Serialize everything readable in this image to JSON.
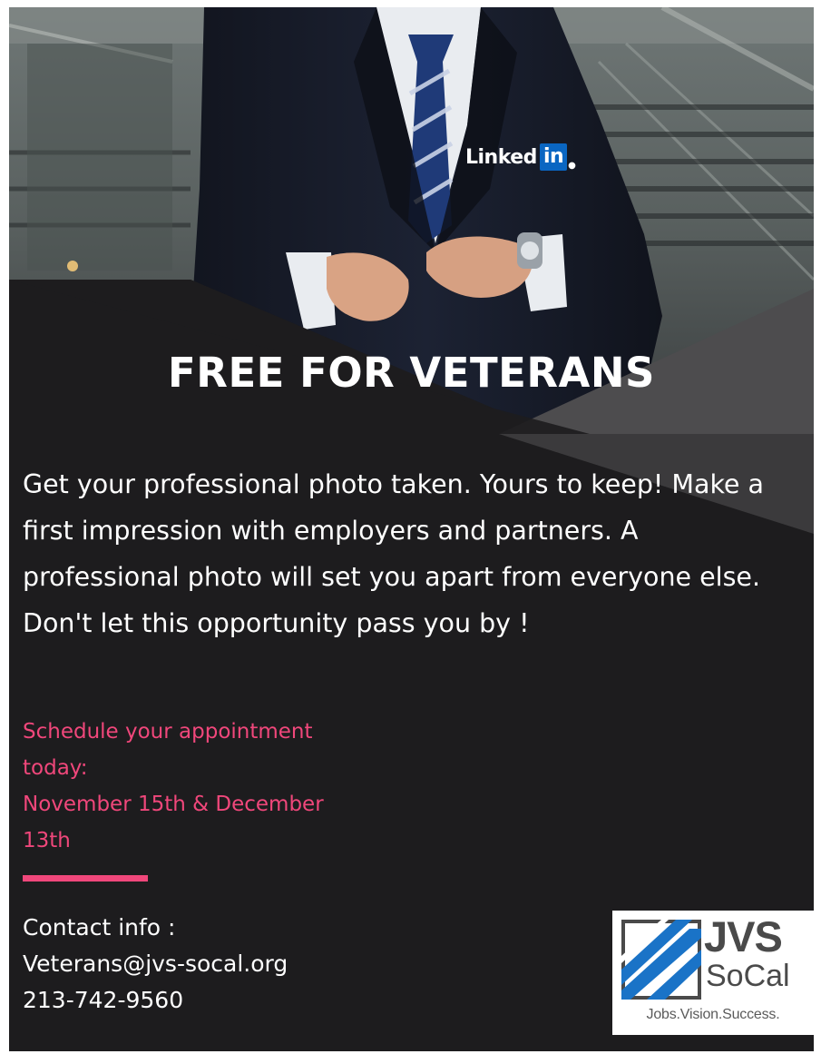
{
  "brand": {
    "linkedin_word": "Linked",
    "linkedin_in": "in"
  },
  "headline": "FREE FOR VETERANS",
  "body_text": "Get your professional photo taken. Yours to keep! Make a first impression with employers and partners. A professional photo will set you apart from everyone else. Don't let this opportunity pass you by !",
  "schedule": {
    "line1": "Schedule your appointment",
    "line2": "today:",
    "line3": "November 15th & December",
    "line4": "13th"
  },
  "contact": {
    "label": "Contact info :",
    "email": "Veterans@jvs-socal.org",
    "phone": "213-742-9560"
  },
  "logo": {
    "name": "JVS",
    "region": "SoCal",
    "tagline": "Jobs.Vision.Success."
  },
  "colors": {
    "background": "#1d1c1e",
    "accent_pink": "#f0477b",
    "linkedin_blue": "#0a66c2",
    "logo_blue": "#1a73c7",
    "logo_gray": "#4a4a4a"
  }
}
